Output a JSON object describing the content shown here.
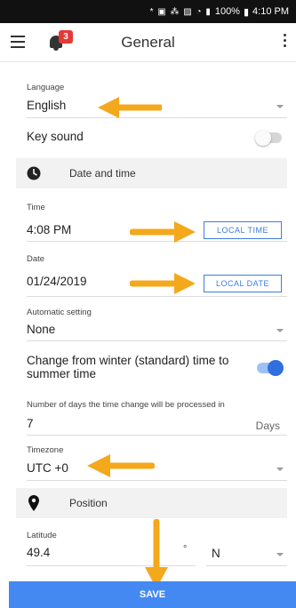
{
  "status_bar": {
    "icons": "* ▣ ⁂ ▨ ◔ ▮",
    "battery": "100%",
    "time": "4:10 PM"
  },
  "header": {
    "title": "General",
    "notification_count": "3"
  },
  "language": {
    "label": "Language",
    "value": "English"
  },
  "key_sound": {
    "label": "Key sound",
    "enabled": false
  },
  "date_time_section": {
    "title": "Date and time"
  },
  "time": {
    "label": "Time",
    "value": "4:08 PM",
    "button": "LOCAL TIME"
  },
  "date": {
    "label": "Date",
    "value": "01/24/2019",
    "button": "LOCAL DATE"
  },
  "automatic_setting": {
    "label": "Automatic setting",
    "value": "None"
  },
  "summer_time": {
    "label": "Change from winter (standard) time to summer time",
    "enabled": true
  },
  "days": {
    "label": "Number of days the time change will be processed in",
    "value": "7",
    "unit": "Days"
  },
  "timezone": {
    "label": "Timezone",
    "value": "UTC +0"
  },
  "position_section": {
    "title": "Position"
  },
  "latitude": {
    "label": "Latitude",
    "value": "49.4",
    "degree_symbol": "°",
    "direction": "N"
  },
  "save_button": "SAVE",
  "colors": {
    "accent": "#3b7ddd",
    "save_bar": "#4489f2",
    "arrow": "#f4a81c",
    "badge": "#e53935"
  }
}
